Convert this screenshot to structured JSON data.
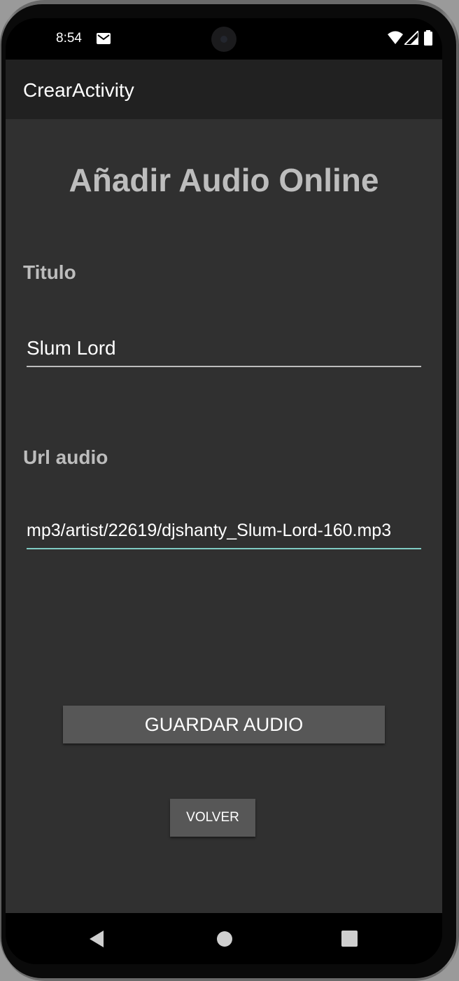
{
  "status_bar": {
    "time": "8:54",
    "icons": [
      "mail-icon",
      "wifi-icon",
      "signal-icon",
      "battery-icon"
    ]
  },
  "app_bar": {
    "title": "CrearActivity"
  },
  "main": {
    "heading": "Añadir Audio Online",
    "titulo_label": "Titulo",
    "titulo_value": "Slum Lord",
    "url_label": "Url audio",
    "url_value": "mp3/artist/22619/djshanty_Slum-Lord-160.mp3",
    "save_button_label": "GUARDAR AUDIO",
    "back_button_label": "VOLVER"
  },
  "nav_bar": {
    "icons": [
      "back-icon",
      "home-icon",
      "recents-icon"
    ]
  },
  "colors": {
    "background": "#303030",
    "app_bar": "#212121",
    "accent": "#80cbc4",
    "button": "#575757",
    "heading_text": "#bdbdbd"
  }
}
